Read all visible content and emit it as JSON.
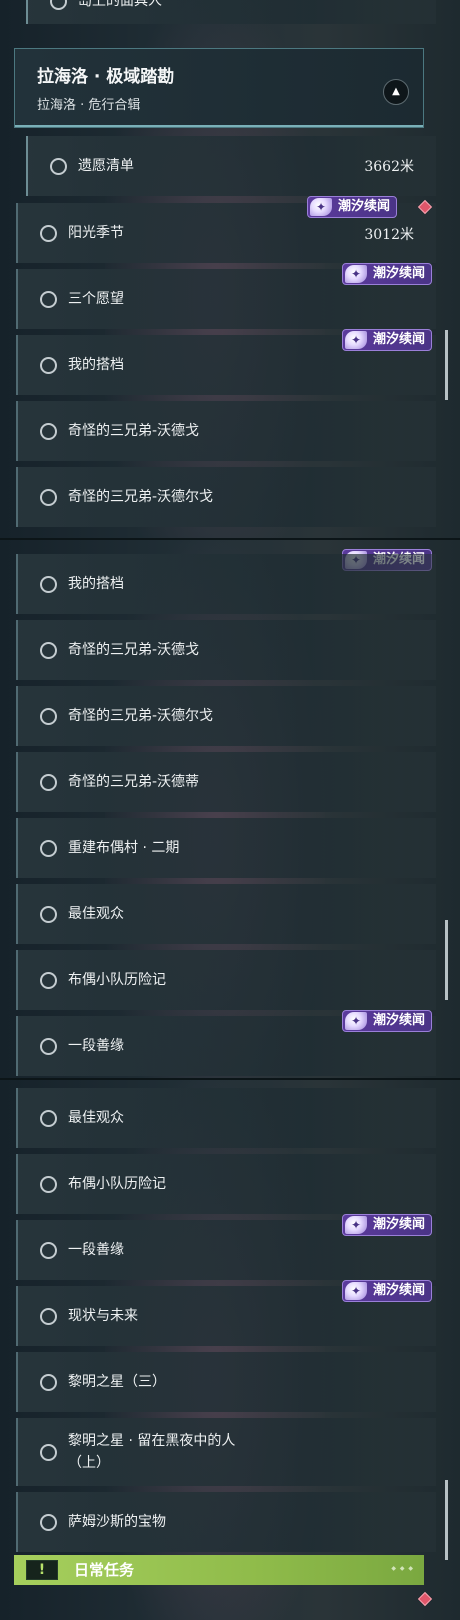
{
  "panel1": {
    "top_partial_item": "岛上的面具人",
    "header": {
      "title": "拉海洛 · 极域踏勘",
      "subtitle": "拉海洛 · 危行合辑",
      "collapse_icon": "chevron-up-icon"
    },
    "items": [
      {
        "label": "遗愿清单",
        "distance": "3662米"
      },
      {
        "label": "阳光季节",
        "distance": "3012米"
      },
      {
        "label": "三个愿望"
      },
      {
        "label": "我的搭档"
      },
      {
        "label": "奇怪的三兄弟-沃德戈"
      },
      {
        "label": "奇怪的三兄弟-沃德尔戈"
      }
    ]
  },
  "panel2": {
    "items": [
      {
        "label": "我的搭档"
      },
      {
        "label": "奇怪的三兄弟-沃德戈"
      },
      {
        "label": "奇怪的三兄弟-沃德尔戈"
      },
      {
        "label": "奇怪的三兄弟-沃德蒂"
      },
      {
        "label": "重建布偶村 · 二期"
      },
      {
        "label": "最佳观众"
      },
      {
        "label": "布偶小队历险记"
      },
      {
        "label": "一段善缘"
      }
    ]
  },
  "panel3": {
    "items": [
      {
        "label": "最佳观众"
      },
      {
        "label": "布偶小队历险记"
      },
      {
        "label": "一段善缘"
      },
      {
        "label": "现状与未来"
      },
      {
        "label": "黎明之星（三）"
      },
      {
        "label": "黎明之星 · 留在黑夜中的人",
        "label_line2": "（上）"
      },
      {
        "label": "萨姆沙斯的宝物"
      }
    ],
    "daily": {
      "label": "日常任务",
      "icon": "!"
    }
  },
  "badge_text": "潮汐续闻",
  "colors": {
    "badge_purple": "#5b3a9c",
    "daily_green": "#a6cf5d",
    "marker_red": "#e0566a"
  }
}
